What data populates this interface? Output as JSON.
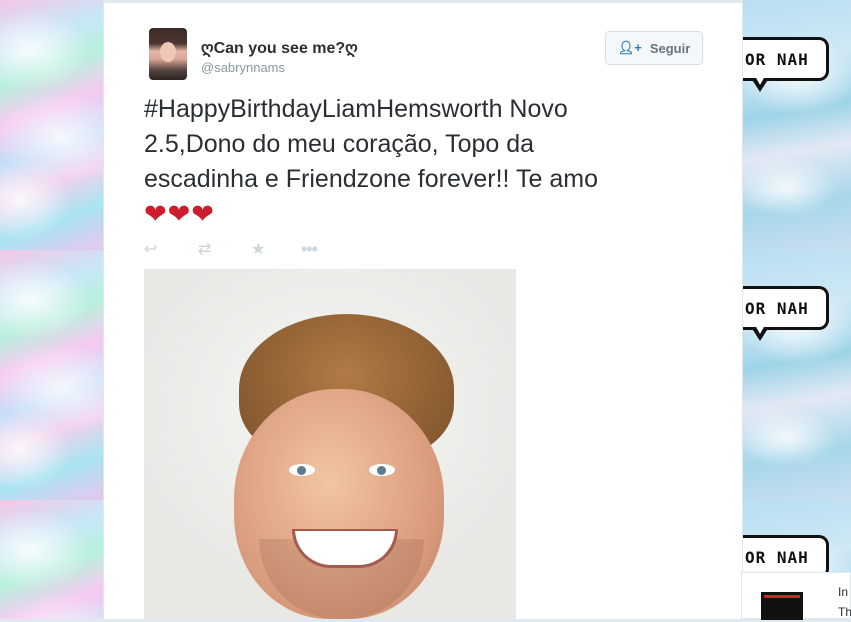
{
  "tweet": {
    "display_name": "ღCan you see me?ღ",
    "handle": "@sabrynnams",
    "follow_label": "Seguir",
    "follow_icon": "add-user-icon",
    "text": "#HappyBirthdayLiamHemsworth  Novo 2.5,Dono do meu coração, Topo da escadinha  e Friendzone forever!! Te amo",
    "hearts": "❤❤❤",
    "actions": [
      {
        "name": "reply",
        "icon": "reply-icon",
        "glyph": "↩"
      },
      {
        "name": "retweet",
        "icon": "retweet-icon",
        "glyph": "⇄"
      },
      {
        "name": "favorite",
        "icon": "star-icon",
        "glyph": "★"
      },
      {
        "name": "more",
        "icon": "more-icon",
        "glyph": "•••"
      }
    ]
  },
  "background": {
    "bubble_text": "OR NAH"
  },
  "side_card": {
    "line1": "In",
    "line2": "Th"
  },
  "colors": {
    "heart": "#cc1c2e",
    "text": "#292f33",
    "muted": "#8899a6",
    "accent": "#2b7bb9"
  }
}
